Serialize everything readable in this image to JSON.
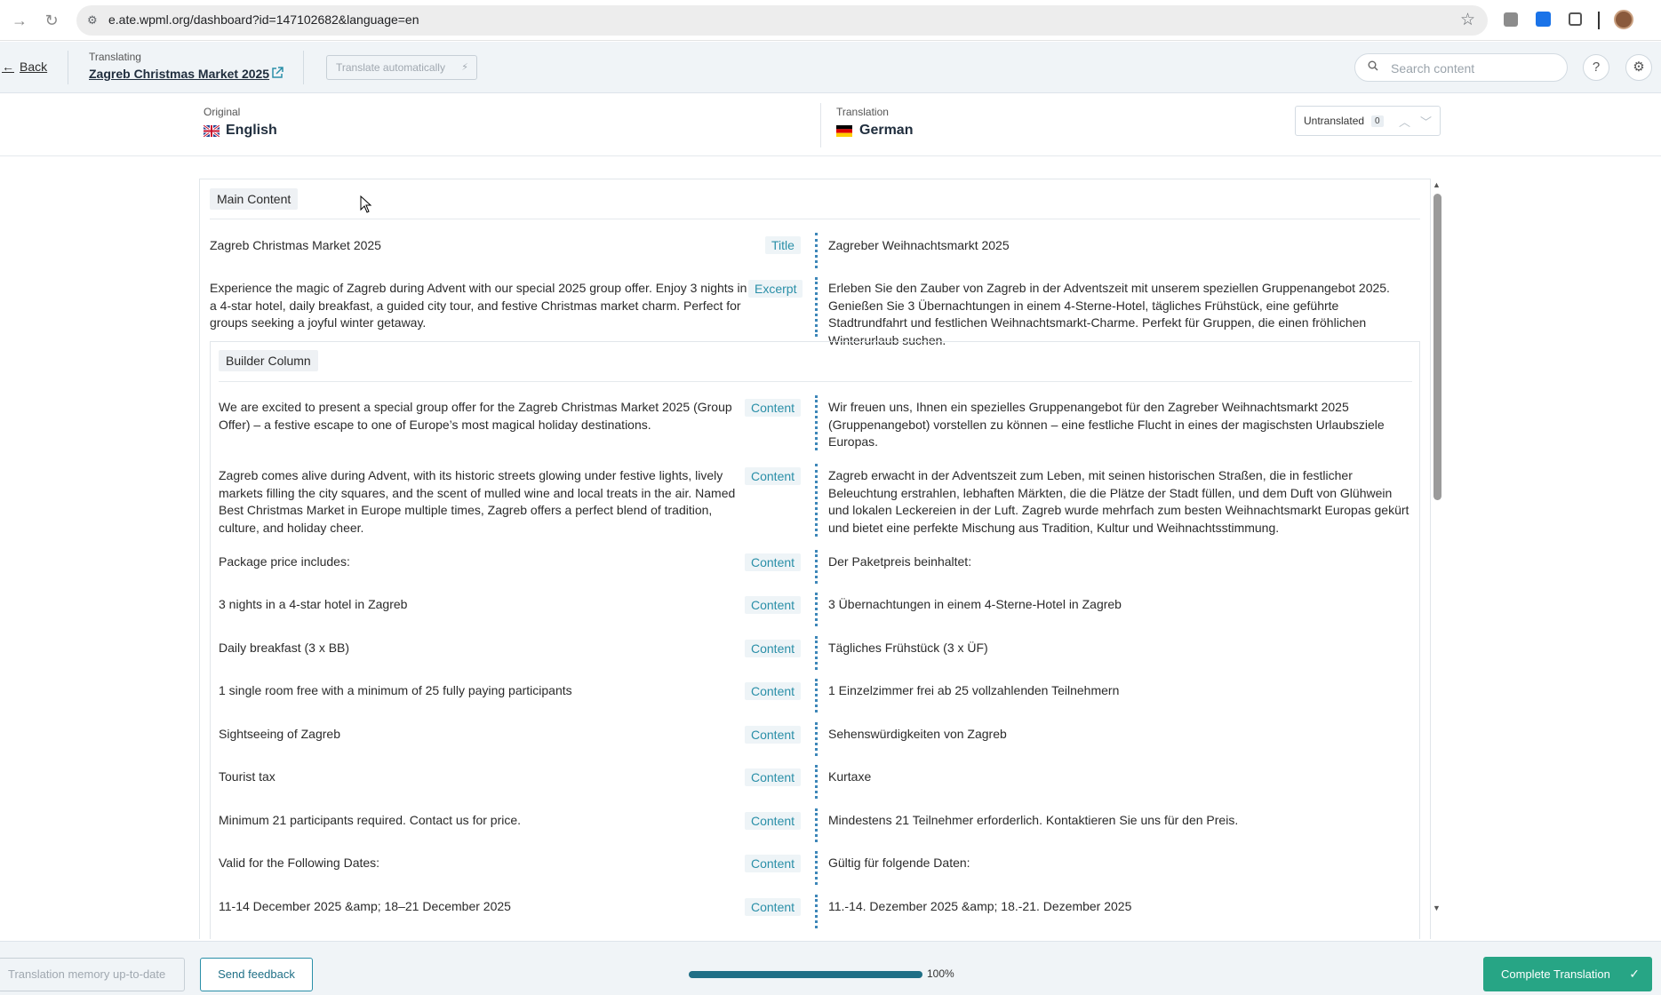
{
  "browser": {
    "url": "e.ate.wpml.org/dashboard?id=147102682&language=en"
  },
  "header": {
    "back_label": "Back",
    "translating_label": "Translating",
    "doc_title": "Zagreb Christmas Market 2025",
    "auto_translate_label": "Translate automatically",
    "search_placeholder": "Search content"
  },
  "languages": {
    "original_label": "Original",
    "original_name": "English",
    "translation_label": "Translation",
    "translation_name": "German",
    "untranslated_label": "Untranslated",
    "untranslated_count": "0"
  },
  "sections": {
    "main_content": "Main Content",
    "builder_column": "Builder Column"
  },
  "rows": [
    {
      "source": "Zagreb Christmas Market 2025",
      "type": "Title",
      "target": "Zagreber Weihnachtsmarkt 2025"
    },
    {
      "source": "Experience the magic of Zagreb during Advent with our special 2025 group offer. Enjoy 3 nights in a 4-star hotel, daily breakfast, a guided city tour, and festive Christmas market charm. Perfect for groups seeking a joyful winter getaway.",
      "type": "Excerpt",
      "target": "Erleben Sie den Zauber von Zagreb in der Adventszeit mit unserem speziellen Gruppenangebot 2025. Genießen Sie 3 Übernachtungen in einem 4-Sterne-Hotel, tägliches Frühstück, eine geführte Stadtrundfahrt und festlichen Weihnachtsmarkt-Charme. Perfekt für Gruppen, die einen fröhlichen Winterurlaub suchen."
    },
    {
      "source": "We are excited to present a special group offer for the Zagreb Christmas Market 2025 (Group Offer) – a festive escape to one of Europe’s most magical holiday destinations.",
      "type": "Content",
      "target": "Wir freuen uns, Ihnen ein spezielles Gruppenangebot für den Zagreber Weihnachtsmarkt 2025 (Gruppenangebot) vorstellen zu können – eine festliche Flucht in eines der magischsten Urlaubsziele Europas."
    },
    {
      "source": "Zagreb comes alive during Advent, with its historic streets glowing under festive lights, lively markets filling the city squares, and the scent of mulled wine and local treats in the air. Named Best Christmas Market in Europe multiple times, Zagreb offers a perfect blend of tradition, culture, and holiday cheer.",
      "type": "Content",
      "target": "Zagreb erwacht in der Adventszeit zum Leben, mit seinen historischen Straßen, die in festlicher Beleuchtung erstrahlen, lebhaften Märkten, die die Plätze der Stadt füllen, und dem Duft von Glühwein und lokalen Leckereien in der Luft. Zagreb wurde mehrfach zum besten Weihnachtsmarkt Europas gekürt und bietet eine perfekte Mischung aus Tradition, Kultur und Weihnachtsstimmung."
    },
    {
      "source": "Package price includes:",
      "type": "Content",
      "target": "Der Paketpreis beinhaltet:"
    },
    {
      "source": "3 nights in a 4-star hotel in Zagreb",
      "type": "Content",
      "target": "3 Übernachtungen in einem 4-Sterne-Hotel in Zagreb"
    },
    {
      "source": "Daily breakfast (3 x BB)",
      "type": "Content",
      "target": "Tägliches Frühstück (3 x ÜF)"
    },
    {
      "source": "1 single room free with a minimum of 25 fully paying participants",
      "type": "Content",
      "target": "1 Einzelzimmer frei ab 25 vollzahlenden Teilnehmern"
    },
    {
      "source": "Sightseeing of Zagreb",
      "type": "Content",
      "target": "Sehenswürdigkeiten von Zagreb"
    },
    {
      "source": "Tourist tax",
      "type": "Content",
      "target": "Kurtaxe"
    },
    {
      "source": "Minimum 21 participants required. Contact us for price.",
      "type": "Content",
      "target": "Mindestens 21 Teilnehmer erforderlich. Kontaktieren Sie uns für den Preis."
    },
    {
      "source": "Valid for the Following Dates:",
      "type": "Content",
      "target": "Gültig für folgende Daten:"
    },
    {
      "source": "11-14 December 2025 &amp; 18–21 December 2025",
      "type": "Content",
      "target": "11.-14. Dezember 2025 &amp; 18.-21. Dezember 2025"
    }
  ],
  "footer": {
    "tm_label": "Translation memory up-to-date",
    "feedback_label": "Send feedback",
    "progress_value": 1.0,
    "progress_label": "100%",
    "complete_label": "Complete Translation"
  },
  "colors": {
    "accent": "#2a8fa8",
    "complete": "#27a585",
    "progress": "#1f6f86"
  }
}
